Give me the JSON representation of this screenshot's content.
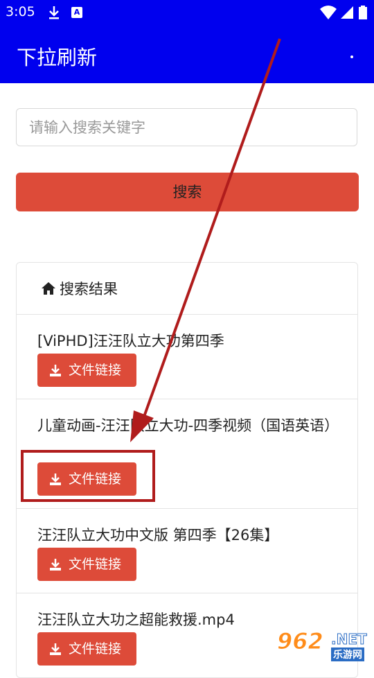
{
  "status": {
    "time": "3:05"
  },
  "app": {
    "title": "下拉刷新"
  },
  "search": {
    "placeholder": "请输入搜索关键字",
    "button_label": "搜索"
  },
  "results": {
    "title": "搜索结果",
    "items": [
      {
        "title": "[ViPHD]汪汪队立大功第四季",
        "button_label": "文件链接"
      },
      {
        "title": "儿童动画-汪汪队立大功-四季视频（国语英语）",
        "button_label": "文件链接"
      },
      {
        "title": "汪汪队立大功中文版 第四季【26集】",
        "button_label": "文件链接"
      },
      {
        "title": "汪汪队立大功之超能救援.mp4",
        "button_label": "文件链接"
      }
    ]
  },
  "watermark": {
    "logo": "962",
    "net": ".NET",
    "site": "乐游网"
  },
  "colors": {
    "app_bar": "#0000ee",
    "button": "#dd4b39",
    "annotation": "#b01c1c"
  }
}
